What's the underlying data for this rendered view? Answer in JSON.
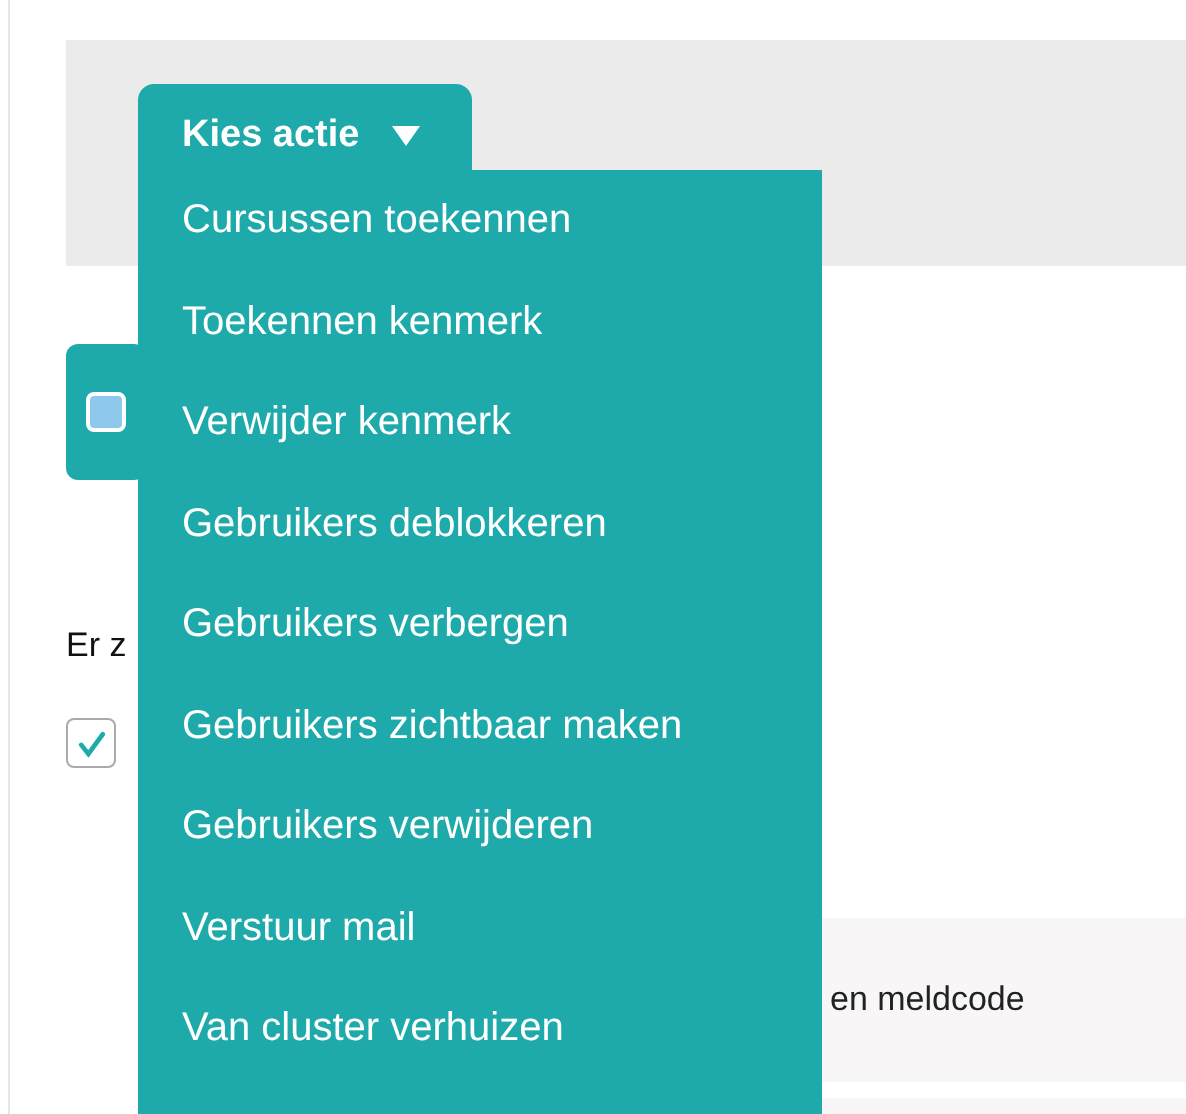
{
  "bulk_bar": {
    "select_all": {
      "checked": false
    }
  },
  "notice": {
    "text": "Er z"
  },
  "row_checkbox": {
    "checked": true
  },
  "info_panel": {
    "text": "en meldcode"
  },
  "action_menu": {
    "label": "Kies actie",
    "expanded": true,
    "items": [
      {
        "label": "Cursussen toekennen"
      },
      {
        "label": "Toekennen kenmerk"
      },
      {
        "label": "Verwijder kenmerk"
      },
      {
        "label": "Gebruikers deblokkeren"
      },
      {
        "label": "Gebruikers verbergen"
      },
      {
        "label": "Gebruikers zichtbaar maken"
      },
      {
        "label": "Gebruikers verwijderen"
      },
      {
        "label": "Verstuur mail"
      },
      {
        "label": "Van cluster verhuizen"
      }
    ]
  }
}
